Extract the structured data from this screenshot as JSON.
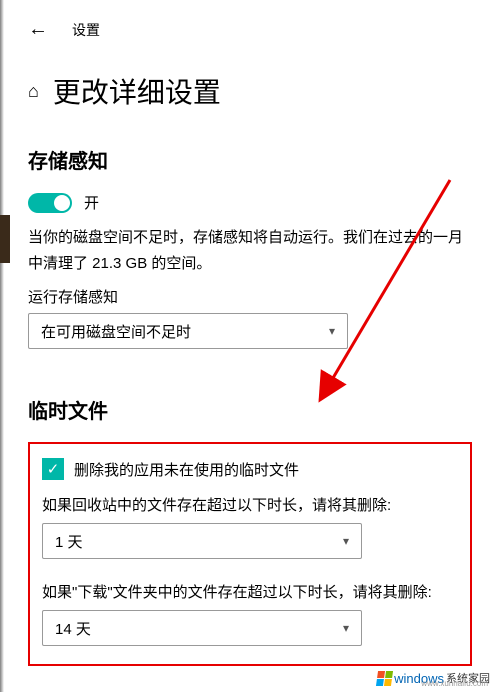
{
  "topbar": {
    "settings_label": "设置"
  },
  "page_title": "更改详细设置",
  "storage_sense": {
    "heading": "存储感知",
    "toggle_state": "开",
    "description": "当你的磁盘空间不足时，存储感知将自动运行。我们在过去的一月中清理了 21.3 GB 的空间。",
    "run_label": "运行存储感知",
    "run_value": "在可用磁盘空间不足时"
  },
  "temp_files": {
    "heading": "临时文件",
    "checkbox_label": "删除我的应用未在使用的临时文件",
    "recycle_label": "如果回收站中的文件存在超过以下时长，请将其删除:",
    "recycle_value": "1 天",
    "downloads_label": "如果\"下载\"文件夹中的文件存在超过以下时长，请将其删除:",
    "downloads_value": "14 天"
  },
  "watermark": {
    "brand": "windows",
    "sub": "系统家园",
    "url": "www.xunhaifu.com"
  }
}
